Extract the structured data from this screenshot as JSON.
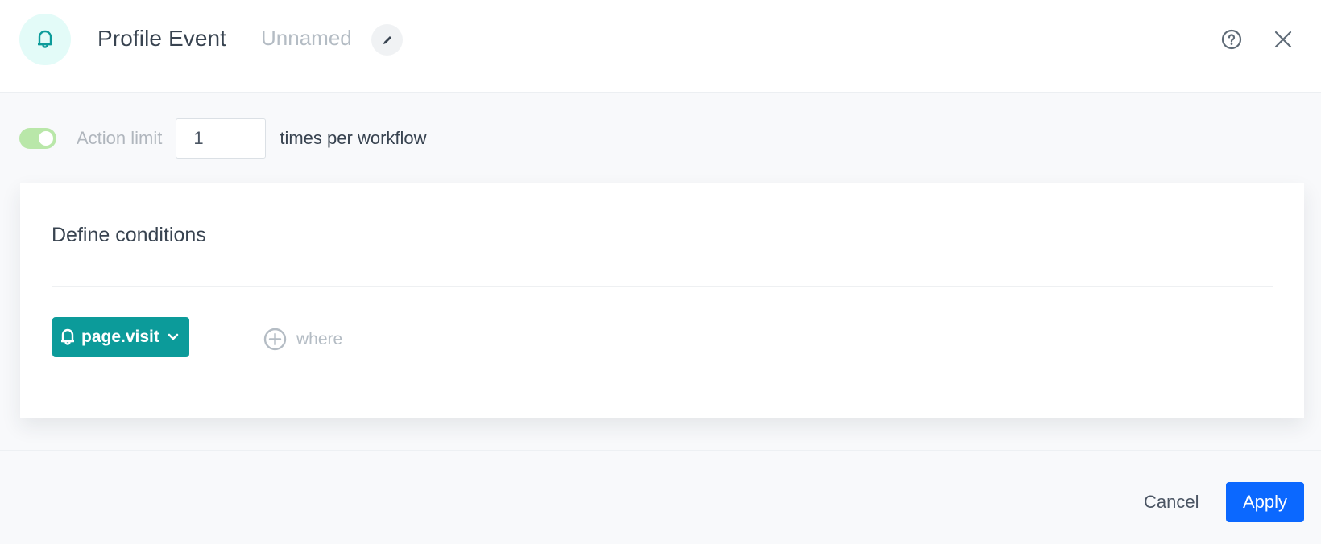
{
  "header": {
    "icon": "bell-icon",
    "title": "Profile Event",
    "name": "Unnamed",
    "edit_icon": "pencil-icon",
    "help_icon": "help-circle-icon",
    "close_icon": "close-icon"
  },
  "action_limit": {
    "enabled": true,
    "label": "Action limit",
    "value": "1",
    "suffix": "times per workflow"
  },
  "conditions": {
    "title": "Define conditions",
    "event": {
      "icon": "bell-icon",
      "label": "page.visit",
      "dropdown_icon": "chevron-down-icon"
    },
    "add_where": {
      "icon": "plus-circle-icon",
      "label": "where"
    }
  },
  "footer": {
    "cancel_label": "Cancel",
    "apply_label": "Apply"
  },
  "colors": {
    "accent": "#0c9b9a",
    "primary": "#0b68ff",
    "toggle_on": "#b9e7a9",
    "icon_bg": "#e3fbf8"
  }
}
